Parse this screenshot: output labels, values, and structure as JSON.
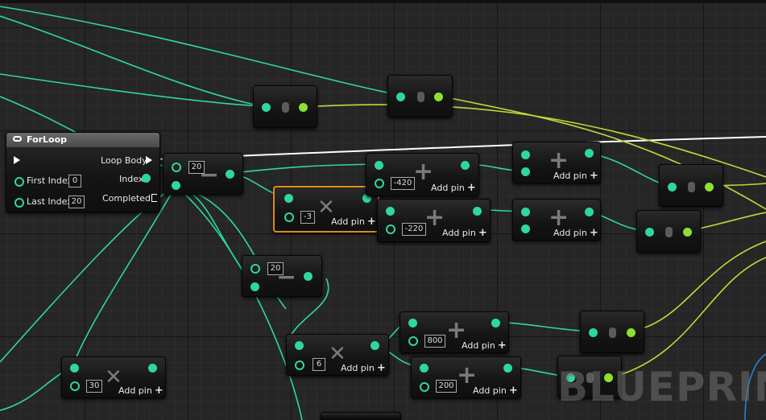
{
  "watermark": "BLUEPRIN",
  "for_loop": {
    "title": "ForLoop",
    "first_index_label": "First Index",
    "first_index_value": "0",
    "last_index_label": "Last Index",
    "last_index_value": "20",
    "loop_body_label": "Loop Body",
    "index_label": "Index",
    "completed_label": "Completed"
  },
  "add_pin_label": "Add pin",
  "operators": {
    "subtract": "−",
    "multiply": "✕",
    "add": "+"
  },
  "values": {
    "subtract_a": "20",
    "subtract_b": "20",
    "multiply_a": "-3",
    "multiply_b": "6",
    "multiply_c": "30",
    "add_a": "-420",
    "add_b": "-220",
    "add_c": "800",
    "add_d": "200"
  },
  "colors": {
    "float_wire": "#2fd7a0",
    "vector_wire": "#b8dc3a",
    "exec_wire": "#ffffff",
    "selection": "#e08a18"
  }
}
